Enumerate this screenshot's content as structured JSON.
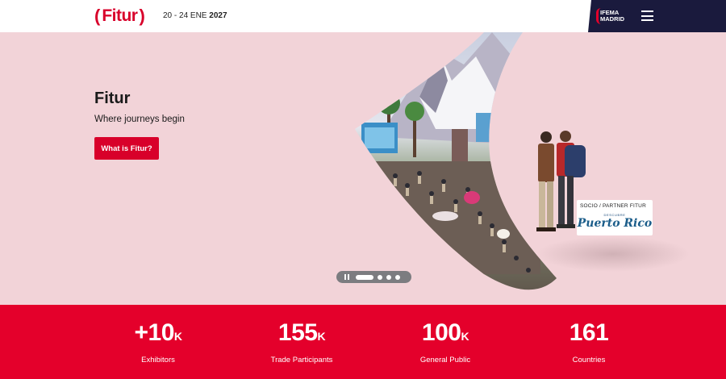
{
  "header": {
    "logo": "Fitur",
    "dates_prefix": "20 - 24 ENE",
    "dates_year": "2027",
    "partner_brand_line1": "IFEMA",
    "partner_brand_line2": "MADRID"
  },
  "hero": {
    "title": "Fitur",
    "subtitle": "Where journeys begin",
    "cta_label": "What is Fitur?",
    "partner_label": "SOCIO / PARTNER FITUR",
    "partner_descubre": "DESCUBRE",
    "partner_name": "Puerto Rico",
    "slides_total": 4,
    "slide_active": 1
  },
  "stats": [
    {
      "value": "+10",
      "unit": "K",
      "label": "Exhibitors"
    },
    {
      "value": "155",
      "unit": "K",
      "label": "Trade Participants"
    },
    {
      "value": "100",
      "unit": "K",
      "label": "General Public"
    },
    {
      "value": "161",
      "unit": "",
      "label": "Countries"
    }
  ],
  "colors": {
    "brand_red": "#e4002b",
    "hero_bg": "#f2d3d8",
    "navy": "#1a1a3d"
  }
}
